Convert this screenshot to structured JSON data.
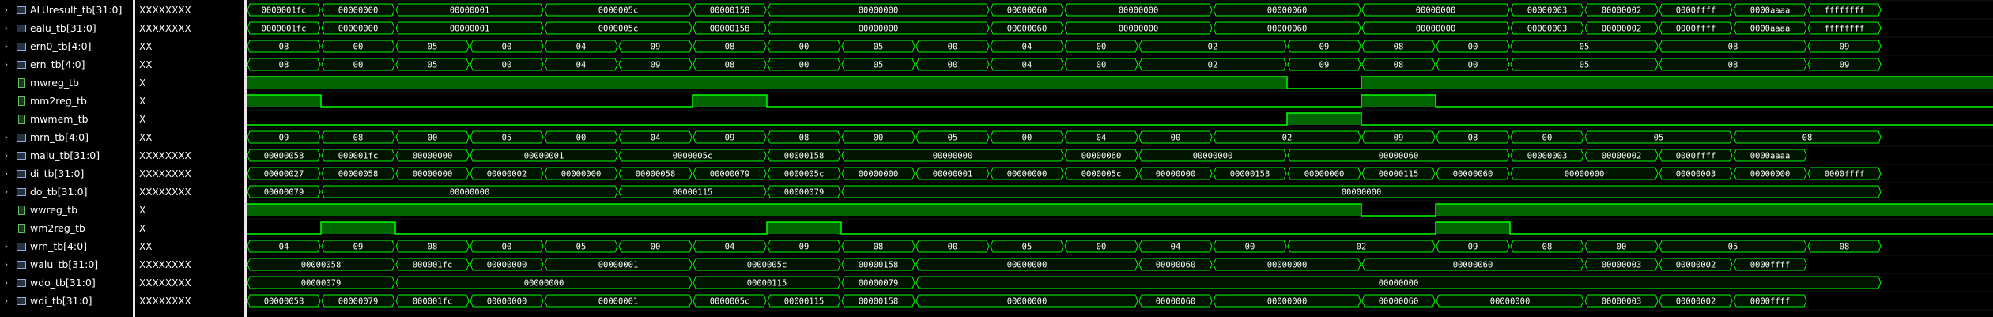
{
  "colors": {
    "wave": "#00ff00",
    "wave_fill": "#006400",
    "bus_fill": "#001400",
    "text": "#ffffff"
  },
  "time_edges": [
    0,
    100,
    200,
    300,
    400,
    500,
    600,
    700,
    800,
    900,
    1000,
    1100,
    1200,
    1300,
    1400,
    1500,
    1600,
    1700,
    1800,
    1900,
    2000,
    2100,
    2200,
    2300,
    2400,
    2500,
    2600,
    2700,
    2800,
    2900,
    3000,
    3100,
    3200,
    3300,
    3400,
    3500,
    3600,
    3700,
    3800,
    3900,
    4000,
    4100,
    4200,
    4300,
    4400,
    4500,
    4600,
    4700
  ],
  "signals": [
    {
      "name": "ALUresult_tb[31:0]",
      "value": "XXXXXXXX",
      "kind": "bus",
      "segs": [
        [
          0,
          2,
          "0000001fc"
        ],
        [
          2,
          4,
          "00000000"
        ],
        [
          4,
          8,
          "00000001"
        ],
        [
          8,
          12,
          "0000005c"
        ],
        [
          12,
          14,
          "00000158"
        ],
        [
          14,
          20,
          "00000000"
        ],
        [
          20,
          22,
          "00000060"
        ],
        [
          22,
          26,
          "00000000"
        ],
        [
          26,
          30,
          "00000060"
        ],
        [
          30,
          34,
          "00000000"
        ],
        [
          34,
          36,
          "00000003"
        ],
        [
          36,
          38,
          "00000002"
        ],
        [
          38,
          40,
          "0000ffff"
        ],
        [
          40,
          42,
          "0000aaaa"
        ],
        [
          42,
          44,
          "ffffffff"
        ]
      ]
    },
    {
      "name": "ealu_tb[31:0]",
      "value": "XXXXXXXX",
      "kind": "bus",
      "segs": [
        [
          0,
          2,
          "0000001fc"
        ],
        [
          2,
          4,
          "00000000"
        ],
        [
          4,
          8,
          "00000001"
        ],
        [
          8,
          12,
          "0000005c"
        ],
        [
          12,
          14,
          "00000158"
        ],
        [
          14,
          20,
          "00000000"
        ],
        [
          20,
          22,
          "00000060"
        ],
        [
          22,
          26,
          "00000000"
        ],
        [
          26,
          30,
          "00000060"
        ],
        [
          30,
          34,
          "00000000"
        ],
        [
          34,
          36,
          "00000003"
        ],
        [
          36,
          38,
          "00000002"
        ],
        [
          38,
          40,
          "0000ffff"
        ],
        [
          40,
          42,
          "0000aaaa"
        ],
        [
          42,
          44,
          "ffffffff"
        ]
      ]
    },
    {
      "name": "ern0_tb[4:0]",
      "value": "XX",
      "kind": "bus",
      "segs": [
        [
          0,
          2,
          "08"
        ],
        [
          2,
          4,
          "00"
        ],
        [
          4,
          6,
          "05"
        ],
        [
          6,
          8,
          "00"
        ],
        [
          8,
          10,
          "04"
        ],
        [
          10,
          12,
          "09"
        ],
        [
          12,
          14,
          "08"
        ],
        [
          14,
          16,
          "00"
        ],
        [
          16,
          18,
          "05"
        ],
        [
          18,
          20,
          "00"
        ],
        [
          20,
          22,
          "04"
        ],
        [
          22,
          24,
          "00"
        ],
        [
          24,
          28,
          "02"
        ],
        [
          28,
          30,
          "09"
        ],
        [
          30,
          32,
          "08"
        ],
        [
          32,
          34,
          "00"
        ],
        [
          34,
          38,
          "05"
        ],
        [
          38,
          42,
          "08"
        ],
        [
          42,
          44,
          "09"
        ]
      ]
    },
    {
      "name": "ern_tb[4:0]",
      "value": "XX",
      "kind": "bus",
      "segs": [
        [
          0,
          2,
          "08"
        ],
        [
          2,
          4,
          "00"
        ],
        [
          4,
          6,
          "05"
        ],
        [
          6,
          8,
          "00"
        ],
        [
          8,
          10,
          "04"
        ],
        [
          10,
          12,
          "09"
        ],
        [
          12,
          14,
          "08"
        ],
        [
          14,
          16,
          "00"
        ],
        [
          16,
          18,
          "05"
        ],
        [
          18,
          20,
          "00"
        ],
        [
          20,
          22,
          "04"
        ],
        [
          22,
          24,
          "00"
        ],
        [
          24,
          28,
          "02"
        ],
        [
          28,
          30,
          "09"
        ],
        [
          30,
          32,
          "08"
        ],
        [
          32,
          34,
          "00"
        ],
        [
          34,
          38,
          "05"
        ],
        [
          38,
          42,
          "08"
        ],
        [
          42,
          44,
          "09"
        ]
      ]
    },
    {
      "name": "mwreg_tb",
      "value": "X",
      "kind": "bit",
      "levels": [
        1,
        1,
        1,
        1,
        1,
        1,
        1,
        1,
        1,
        1,
        1,
        1,
        1,
        1,
        1,
        1,
        1,
        1,
        1,
        1,
        1,
        1,
        1,
        1,
        1,
        1,
        1,
        1,
        0,
        0,
        1,
        1,
        1,
        1,
        1,
        1,
        1,
        1,
        1,
        1,
        1,
        1,
        1,
        1,
        1,
        1,
        1
      ]
    },
    {
      "name": "mm2reg_tb",
      "value": "X",
      "kind": "bit",
      "levels": [
        1,
        1,
        0,
        0,
        0,
        0,
        0,
        0,
        0,
        0,
        0,
        0,
        1,
        1,
        0,
        0,
        0,
        0,
        0,
        0,
        0,
        0,
        0,
        0,
        0,
        0,
        0,
        0,
        0,
        0,
        1,
        1,
        0,
        0,
        0,
        0,
        0,
        0,
        0,
        0,
        0,
        0,
        0,
        0,
        0,
        0,
        0
      ]
    },
    {
      "name": "mwmem_tb",
      "value": "X",
      "kind": "bit",
      "levels": [
        0,
        0,
        0,
        0,
        0,
        0,
        0,
        0,
        0,
        0,
        0,
        0,
        0,
        0,
        0,
        0,
        0,
        0,
        0,
        0,
        0,
        0,
        0,
        0,
        0,
        0,
        0,
        0,
        1,
        1,
        0,
        0,
        0,
        0,
        0,
        0,
        0,
        0,
        0,
        0,
        0,
        0,
        0,
        0,
        0,
        0,
        0
      ]
    },
    {
      "name": "mrn_tb[4:0]",
      "value": "XX",
      "kind": "bus",
      "segs": [
        [
          0,
          2,
          "09"
        ],
        [
          2,
          4,
          "08"
        ],
        [
          4,
          6,
          "00"
        ],
        [
          6,
          8,
          "05"
        ],
        [
          8,
          10,
          "00"
        ],
        [
          10,
          12,
          "04"
        ],
        [
          12,
          14,
          "09"
        ],
        [
          14,
          16,
          "08"
        ],
        [
          16,
          18,
          "00"
        ],
        [
          18,
          20,
          "05"
        ],
        [
          20,
          22,
          "00"
        ],
        [
          22,
          24,
          "04"
        ],
        [
          24,
          26,
          "00"
        ],
        [
          26,
          30,
          "02"
        ],
        [
          30,
          32,
          "09"
        ],
        [
          32,
          34,
          "08"
        ],
        [
          34,
          36,
          "00"
        ],
        [
          36,
          40,
          "05"
        ],
        [
          40,
          44,
          "08"
        ]
      ]
    },
    {
      "name": "malu_tb[31:0]",
      "value": "XXXXXXXX",
      "kind": "bus",
      "segs": [
        [
          0,
          2,
          "00000058"
        ],
        [
          2,
          4,
          "000001fc"
        ],
        [
          4,
          6,
          "00000000"
        ],
        [
          6,
          10,
          "00000001"
        ],
        [
          10,
          14,
          "0000005c"
        ],
        [
          14,
          16,
          "00000158"
        ],
        [
          16,
          22,
          "00000000"
        ],
        [
          22,
          24,
          "00000060"
        ],
        [
          24,
          28,
          "00000000"
        ],
        [
          28,
          34,
          "00000060"
        ],
        [
          34,
          36,
          "00000003"
        ],
        [
          36,
          38,
          "00000002"
        ],
        [
          38,
          40,
          "0000ffff"
        ],
        [
          40,
          42,
          "0000aaaa"
        ]
      ]
    },
    {
      "name": "di_tb[31:0]",
      "value": "XXXXXXXX",
      "kind": "bus",
      "segs": [
        [
          0,
          2,
          "00000027"
        ],
        [
          2,
          4,
          "00000058"
        ],
        [
          4,
          6,
          "00000000"
        ],
        [
          6,
          8,
          "00000002"
        ],
        [
          8,
          10,
          "00000000"
        ],
        [
          10,
          12,
          "00000058"
        ],
        [
          12,
          14,
          "00000079"
        ],
        [
          14,
          16,
          "0000005c"
        ],
        [
          16,
          18,
          "00000000"
        ],
        [
          18,
          20,
          "00000001"
        ],
        [
          20,
          22,
          "00000000"
        ],
        [
          22,
          24,
          "0000005c"
        ],
        [
          24,
          26,
          "00000000"
        ],
        [
          26,
          28,
          "00000158"
        ],
        [
          28,
          30,
          "00000000"
        ],
        [
          30,
          32,
          "00000115"
        ],
        [
          32,
          34,
          "00000060"
        ],
        [
          34,
          38,
          "00000000"
        ],
        [
          38,
          40,
          "00000003"
        ],
        [
          40,
          42,
          "00000000"
        ],
        [
          42,
          44,
          "0000ffff"
        ]
      ]
    },
    {
      "name": "do_tb[31:0]",
      "value": "XXXXXXXX",
      "kind": "bus",
      "segs": [
        [
          0,
          2,
          "00000079"
        ],
        [
          2,
          10,
          "00000000"
        ],
        [
          10,
          14,
          "00000115"
        ],
        [
          14,
          16,
          "00000079"
        ],
        [
          16,
          44,
          "00000000"
        ]
      ]
    },
    {
      "name": "wwreg_tb",
      "value": "X",
      "kind": "bit",
      "levels": [
        1,
        1,
        1,
        1,
        1,
        1,
        1,
        1,
        1,
        1,
        1,
        1,
        1,
        1,
        1,
        1,
        1,
        1,
        1,
        1,
        1,
        1,
        1,
        1,
        1,
        1,
        1,
        1,
        1,
        1,
        0,
        0,
        1,
        1,
        1,
        1,
        1,
        1,
        1,
        1,
        1,
        1,
        1,
        1,
        1,
        1,
        1
      ]
    },
    {
      "name": "wm2reg_tb",
      "value": "X",
      "kind": "bit",
      "levels": [
        0,
        0,
        1,
        1,
        0,
        0,
        0,
        0,
        0,
        0,
        0,
        0,
        0,
        0,
        1,
        1,
        0,
        0,
        0,
        0,
        0,
        0,
        0,
        0,
        0,
        0,
        0,
        0,
        0,
        0,
        0,
        0,
        1,
        1,
        0,
        0,
        0,
        0,
        0,
        0,
        0,
        0,
        0,
        0,
        0,
        0,
        0
      ]
    },
    {
      "name": "wrn_tb[4:0]",
      "value": "XX",
      "kind": "bus",
      "segs": [
        [
          0,
          2,
          "04"
        ],
        [
          2,
          4,
          "09"
        ],
        [
          4,
          6,
          "08"
        ],
        [
          6,
          8,
          "00"
        ],
        [
          8,
          10,
          "05"
        ],
        [
          10,
          12,
          "00"
        ],
        [
          12,
          14,
          "04"
        ],
        [
          14,
          16,
          "09"
        ],
        [
          16,
          18,
          "08"
        ],
        [
          18,
          20,
          "00"
        ],
        [
          20,
          22,
          "05"
        ],
        [
          22,
          24,
          "00"
        ],
        [
          24,
          26,
          "04"
        ],
        [
          26,
          28,
          "00"
        ],
        [
          28,
          32,
          "02"
        ],
        [
          32,
          34,
          "09"
        ],
        [
          34,
          36,
          "08"
        ],
        [
          36,
          38,
          "00"
        ],
        [
          38,
          42,
          "05"
        ],
        [
          42,
          44,
          "08"
        ]
      ]
    },
    {
      "name": "walu_tb[31:0]",
      "value": "XXXXXXXX",
      "kind": "bus",
      "segs": [
        [
          0,
          4,
          "00000058"
        ],
        [
          4,
          6,
          "000001fc"
        ],
        [
          6,
          8,
          "00000000"
        ],
        [
          8,
          12,
          "00000001"
        ],
        [
          12,
          16,
          "0000005c"
        ],
        [
          16,
          18,
          "00000158"
        ],
        [
          18,
          24,
          "00000000"
        ],
        [
          24,
          26,
          "00000060"
        ],
        [
          26,
          30,
          "00000000"
        ],
        [
          30,
          36,
          "00000060"
        ],
        [
          36,
          38,
          "00000003"
        ],
        [
          38,
          40,
          "00000002"
        ],
        [
          40,
          42,
          "0000ffff"
        ]
      ]
    },
    {
      "name": "wdo_tb[31:0]",
      "value": "XXXXXXXX",
      "kind": "bus",
      "segs": [
        [
          0,
          4,
          "00000079"
        ],
        [
          4,
          12,
          "00000000"
        ],
        [
          12,
          16,
          "00000115"
        ],
        [
          16,
          18,
          "00000079"
        ],
        [
          18,
          44,
          "00000000"
        ]
      ]
    },
    {
      "name": "wdi_tb[31:0]",
      "value": "XXXXXXXX",
      "kind": "bus",
      "segs": [
        [
          0,
          2,
          "00000058"
        ],
        [
          2,
          4,
          "00000079"
        ],
        [
          4,
          6,
          "000001fc"
        ],
        [
          6,
          8,
          "00000000"
        ],
        [
          8,
          12,
          "00000001"
        ],
        [
          12,
          14,
          "0000005c"
        ],
        [
          14,
          16,
          "00000115"
        ],
        [
          16,
          18,
          "00000158"
        ],
        [
          18,
          24,
          "00000000"
        ],
        [
          24,
          26,
          "00000060"
        ],
        [
          26,
          30,
          "00000000"
        ],
        [
          30,
          32,
          "00000060"
        ],
        [
          32,
          36,
          "00000000"
        ],
        [
          36,
          38,
          "00000003"
        ],
        [
          38,
          40,
          "00000002"
        ],
        [
          40,
          42,
          "0000ffff"
        ]
      ]
    }
  ]
}
